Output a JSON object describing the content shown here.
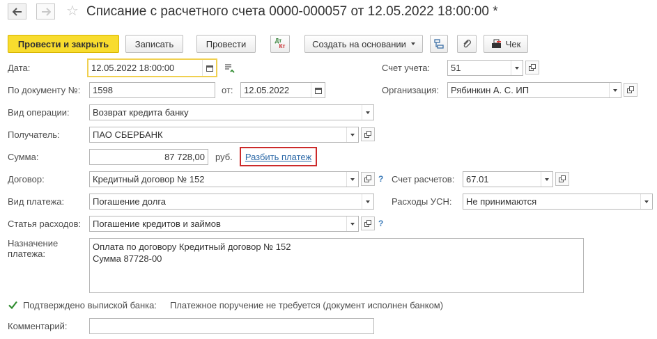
{
  "header": {
    "title": "Списание с расчетного счета 0000-000057 от 12.05.2022 18:00:00 *"
  },
  "toolbar": {
    "post_close": "Провести и закрыть",
    "save": "Записать",
    "post": "Провести",
    "dt_kt_top": "Дт",
    "dt_kt_bottom": "Кт",
    "create_based": "Создать на основании",
    "receipt": "Чек"
  },
  "form": {
    "date_label": "Дата:",
    "date_value": "12.05.2022 18:00:00",
    "doc_no_label": "По документу №:",
    "doc_no_value": "1598",
    "from_label": "от:",
    "from_value": "12.05.2022",
    "operation_label": "Вид операции:",
    "operation_value": "Возврат кредита банку",
    "recipient_label": "Получатель:",
    "recipient_value": "ПАО СБЕРБАНК",
    "sum_label": "Сумма:",
    "sum_value": "87 728,00",
    "currency": "руб.",
    "split_link": "Разбить платеж",
    "contract_label": "Договор:",
    "contract_value": "Кредитный договор № 152",
    "payment_type_label": "Вид платежа:",
    "payment_type_value": "Погашение долга",
    "expense_item_label": "Статья расходов:",
    "expense_item_value": "Погашение кредитов и займов",
    "purpose_label_1": "Назначение",
    "purpose_label_2": "платежа:",
    "purpose_line_1": "Оплата по договору Кредитный договор № 152",
    "purpose_line_2": "Сумма 87728-00",
    "confirmed_label": "Подтверждено выпиской банка:",
    "order_note": "Платежное поручение не требуется (документ исполнен банком)",
    "comment_label": "Комментарий:",
    "comment_value": "",
    "account_label": "Счет учета:",
    "account_value": "51",
    "org_label": "Организация:",
    "org_value": "Рябинкин А. С. ИП",
    "settlement_label": "Счет расчетов:",
    "settlement_value": "67.01",
    "usn_label": "Расходы УСН:",
    "usn_value": "Не принимаются",
    "help_mark": "?"
  },
  "colors": {
    "primary_button": "#f8dc2e",
    "link": "#2e6aa8",
    "highlight_border": "#cc2a2a",
    "focus_border": "#f0d050",
    "checkbox_check": "#2e8b2e"
  }
}
